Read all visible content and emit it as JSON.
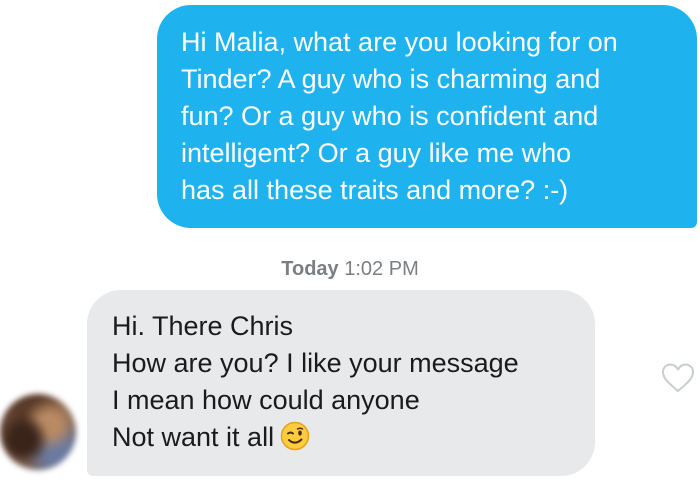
{
  "conversation": {
    "outgoing_message": {
      "lines": [
        "Hi Malia, what are you looking for on",
        "Tinder? A guy who is charming and",
        "fun? Or a guy who is confident and",
        "intelligent? Or a guy like me who",
        "has all these traits and more?  :-)"
      ]
    },
    "timestamp": {
      "day": "Today",
      "time": "1:02 PM"
    },
    "incoming_message": {
      "lines": [
        "Hi. There Chris",
        "How are you? I like your message",
        "I mean how could anyone",
        "Not want it all"
      ],
      "emoji": "winking-face-emoji"
    },
    "like_icon": "heart-outline-icon",
    "sender_avatar": "avatar"
  },
  "colors": {
    "outgoing_bubble": "#1eb3ef",
    "incoming_bubble": "#e8e9eb",
    "timestamp_text": "#7b7f84",
    "heart_outline": "#c9ccd1"
  }
}
